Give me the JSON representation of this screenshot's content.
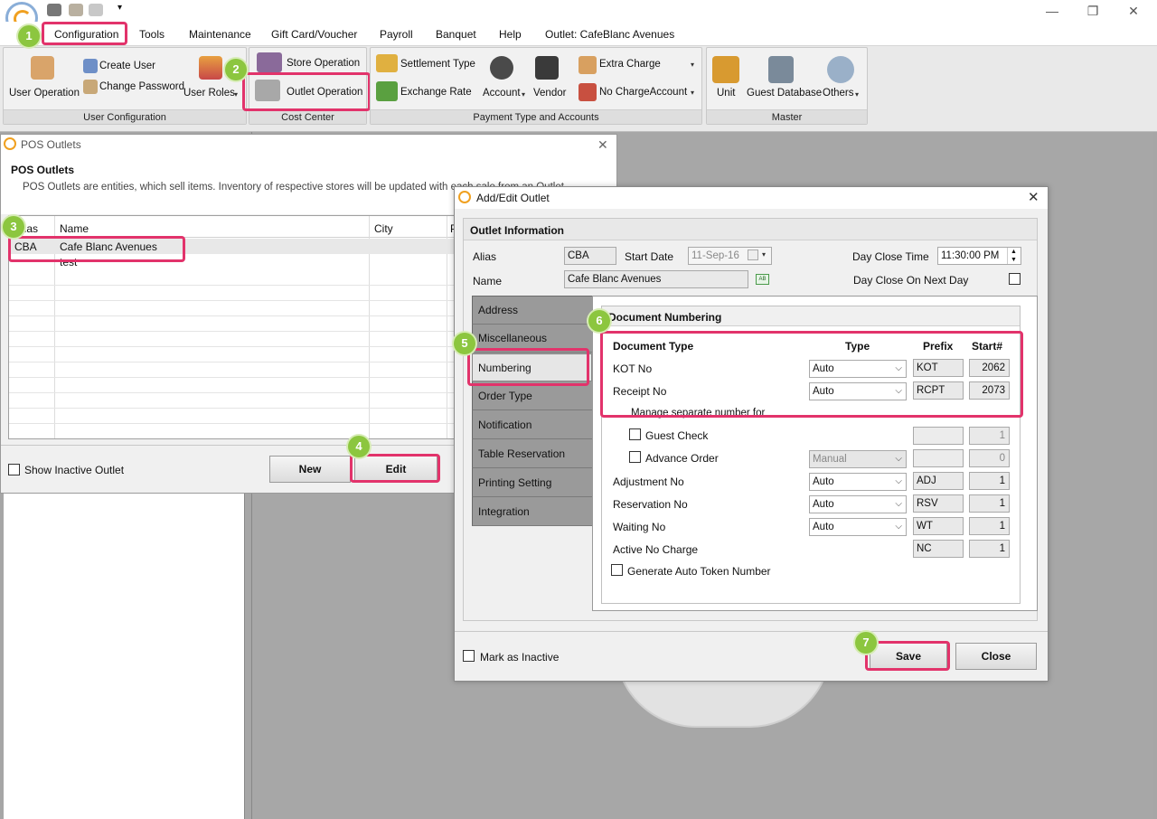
{
  "titlebar": {
    "minimize": "—",
    "restore": "❐",
    "close": "✕"
  },
  "menu": {
    "items": [
      "Configuration",
      "Tools",
      "Maintenance",
      "Gift Card/Voucher",
      "Payroll",
      "Banquet",
      "Help",
      "Outlet: CafeBlanc Avenues"
    ]
  },
  "ribbon": {
    "user_config": {
      "label": "User Configuration",
      "user_operation": "User Operation",
      "create_user": "Create User",
      "change_password": "Change Password",
      "user_roles": "User Roles"
    },
    "cost_center": {
      "label": "Cost Center",
      "store_operation": "Store Operation",
      "outlet_operation": "Outlet Operation"
    },
    "payment": {
      "label": "Payment Type and Accounts",
      "settlement_type": "Settlement Type",
      "exchange_rate": "Exchange Rate",
      "account": "Account",
      "vendor": "Vendor",
      "extra_charge": "Extra Charge",
      "no_charge_account": "No ChargeAccount"
    },
    "master": {
      "label": "Master",
      "unit": "Unit",
      "guest_database": "Guest Database",
      "others": "Others"
    }
  },
  "pos_window": {
    "title": "POS Outlets",
    "heading": "POS Outlets",
    "description": "POS Outlets are entities, which sell items. Inventory of respective stores will be updated with each sale from an Outlet.",
    "columns": [
      "Alias",
      "Name",
      "City",
      "P"
    ],
    "rows": [
      {
        "alias": "CBA",
        "name": "Cafe Blanc Avenues"
      },
      {
        "alias": "",
        "name": "test"
      }
    ],
    "show_inactive": "Show Inactive Outlet",
    "new_button": "New",
    "edit_button": "Edit"
  },
  "dialog": {
    "title": "Add/Edit Outlet",
    "section": "Outlet Information",
    "alias_label": "Alias",
    "alias_value": "CBA",
    "start_date_label": "Start Date",
    "start_date_value": "11-Sep-16",
    "day_close_time_label": "Day Close Time",
    "day_close_time_value": "11:30:00 PM",
    "name_label": "Name",
    "name_value": "Cafe Blanc Avenues",
    "day_close_next_label": "Day Close On Next Day",
    "tabs": [
      "Address",
      "Miscellaneous",
      "Numbering",
      "Order Type",
      "Notification",
      "Table Reservation",
      "Printing Setting",
      "Integration"
    ],
    "numbering": {
      "title": "Document Numbering",
      "headers": {
        "doc_type": "Document Type",
        "type": "Type",
        "prefix": "Prefix",
        "start": "Start#"
      },
      "kot": {
        "label": "KOT No",
        "type": "Auto",
        "prefix": "KOT",
        "start": "2062"
      },
      "receipt": {
        "label": "Receipt No",
        "type": "Auto",
        "prefix": "RCPT",
        "start": "2073"
      },
      "manage_separate": "Manage separate number for",
      "guest_check": {
        "label": "Guest Check",
        "start": "1"
      },
      "advance_order": {
        "label": "Advance Order",
        "type": "Manual",
        "start": "0"
      },
      "adjustment": {
        "label": "Adjustment No",
        "type": "Auto",
        "prefix": "ADJ",
        "start": "1"
      },
      "reservation": {
        "label": "Reservation No",
        "type": "Auto",
        "prefix": "RSV",
        "start": "1"
      },
      "waiting": {
        "label": "Waiting No",
        "type": "Auto",
        "prefix": "WT",
        "start": "1"
      },
      "active_no_charge": {
        "label": "Active No Charge",
        "prefix": "NC",
        "start": "1"
      },
      "auto_token": "Generate Auto Token Number"
    },
    "mark_inactive": "Mark as Inactive",
    "save_button": "Save",
    "close_button": "Close"
  },
  "badges": [
    "1",
    "2",
    "3",
    "4",
    "5",
    "6",
    "7"
  ],
  "colors": {
    "highlight": "#e2336b",
    "badge": "#8cc63f"
  }
}
